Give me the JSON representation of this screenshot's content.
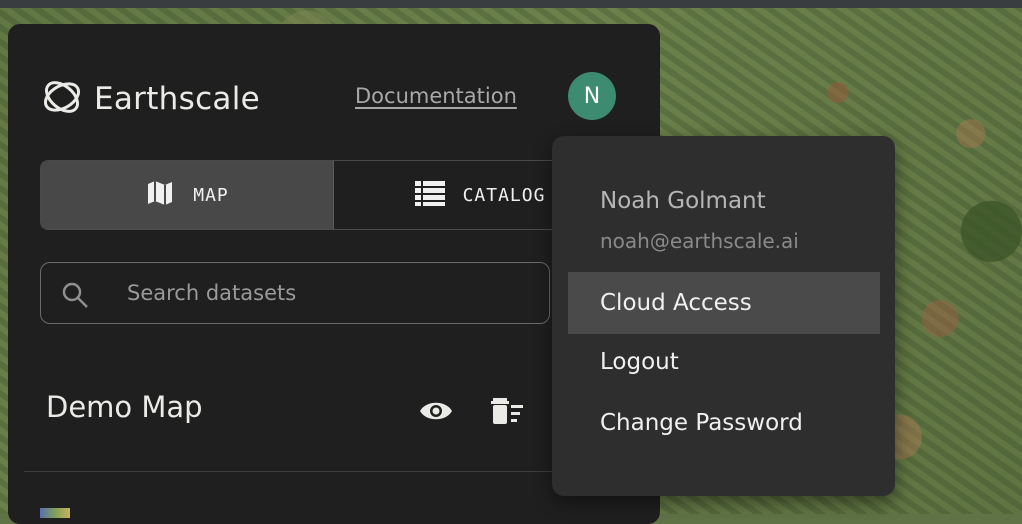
{
  "brand": {
    "name": "Earthscale"
  },
  "header": {
    "documentation_label": "Documentation",
    "avatar_initial": "N"
  },
  "view_toggle": {
    "map_label": "MAP",
    "catalog_label": "CATALOG",
    "active": "map"
  },
  "search": {
    "placeholder": "Search datasets",
    "value": ""
  },
  "map": {
    "title": "Demo Map"
  },
  "user_menu": {
    "name": "Noah Golmant",
    "email": "noah@earthscale.ai",
    "items": [
      "Cloud Access",
      "Logout",
      "Change Password"
    ],
    "highlighted": "Cloud Access"
  },
  "colors": {
    "panel": "#1f1f1f",
    "menu": "#2e2e2e",
    "menu_highlight": "#4a4a4a",
    "avatar": "#3d8c72",
    "text": "#eaeae6"
  },
  "icons": [
    "earthscale-logo-icon",
    "map-icon",
    "catalog-list-icon",
    "search-icon",
    "eye-icon",
    "trash-icon"
  ]
}
